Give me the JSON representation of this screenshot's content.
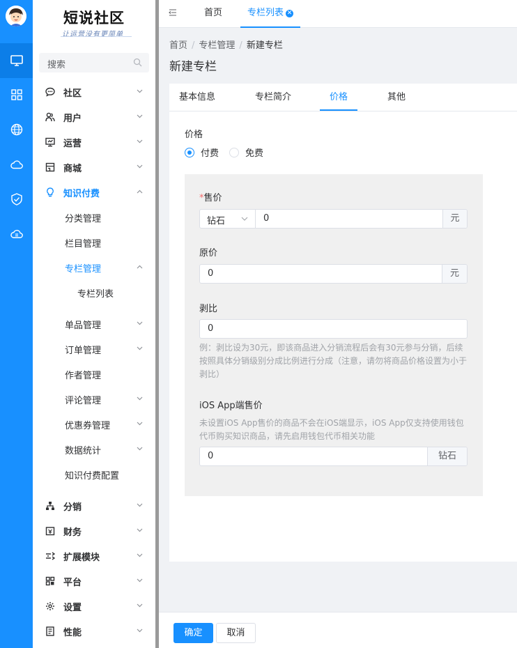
{
  "brand": {
    "logo": "短说社区",
    "slogan": "让运营没有更简单"
  },
  "rail": {
    "icons": [
      "desktop-icon",
      "grid-icon",
      "globe-icon",
      "cloud-icon",
      "shield-check-icon",
      "cloud-sync-icon"
    ]
  },
  "sidebar": {
    "search_placeholder": "搜索",
    "items": [
      {
        "label": "社区",
        "icon": "chat-icon"
      },
      {
        "label": "用户",
        "icon": "users-icon"
      },
      {
        "label": "运营",
        "icon": "monitor-icon"
      },
      {
        "label": "商城",
        "icon": "shop-icon"
      },
      {
        "label": "知识付费",
        "icon": "lightbulb-icon"
      },
      {
        "label": "分销",
        "icon": "org-icon"
      },
      {
        "label": "财务",
        "icon": "wallet-icon"
      },
      {
        "label": "扩展模块",
        "icon": "extend-icon"
      },
      {
        "label": "平台",
        "icon": "platform-icon"
      },
      {
        "label": "设置",
        "icon": "gear-icon"
      },
      {
        "label": "性能",
        "icon": "report-icon"
      }
    ],
    "knowledge_sub": [
      "分类管理",
      "栏目管理",
      "专栏管理",
      "单品管理",
      "订单管理",
      "作者管理",
      "评论管理",
      "优惠券管理",
      "数据统计",
      "知识付费配置"
    ],
    "column_sub": [
      "专栏列表"
    ]
  },
  "topbar": {
    "tabs": [
      "首页",
      "专栏列表"
    ]
  },
  "breadcrumb": [
    "首页",
    "专栏管理",
    "新建专栏"
  ],
  "page_title": "新建专栏",
  "form_tabs": [
    "基本信息",
    "专栏简介",
    "价格",
    "其他"
  ],
  "price": {
    "label": "价格",
    "options": [
      "付费",
      "免费"
    ],
    "selected": "付费",
    "sale_label": "售价",
    "currency": "钻石",
    "sale_value": "0",
    "unit": "元",
    "original_label": "原价",
    "original_value": "0",
    "ratio_label": "剥比",
    "ratio_value": "0",
    "ratio_note": "例：剥比设为30元，即该商品进入分销流程后会有30元参与分销，后续按照具体分销级别分成比例进行分成（注意，请勿将商品价格设置为小于剥比）",
    "ios_label": "iOS App端售价",
    "ios_note": "未设置iOS App售价的商品不会在iOS端显示，iOS App仅支持使用钱包代币购买知识商品，请先启用钱包代币相关功能",
    "ios_value": "0",
    "ios_unit": "钻石"
  },
  "footer": {
    "confirm": "确定",
    "cancel": "取消"
  }
}
